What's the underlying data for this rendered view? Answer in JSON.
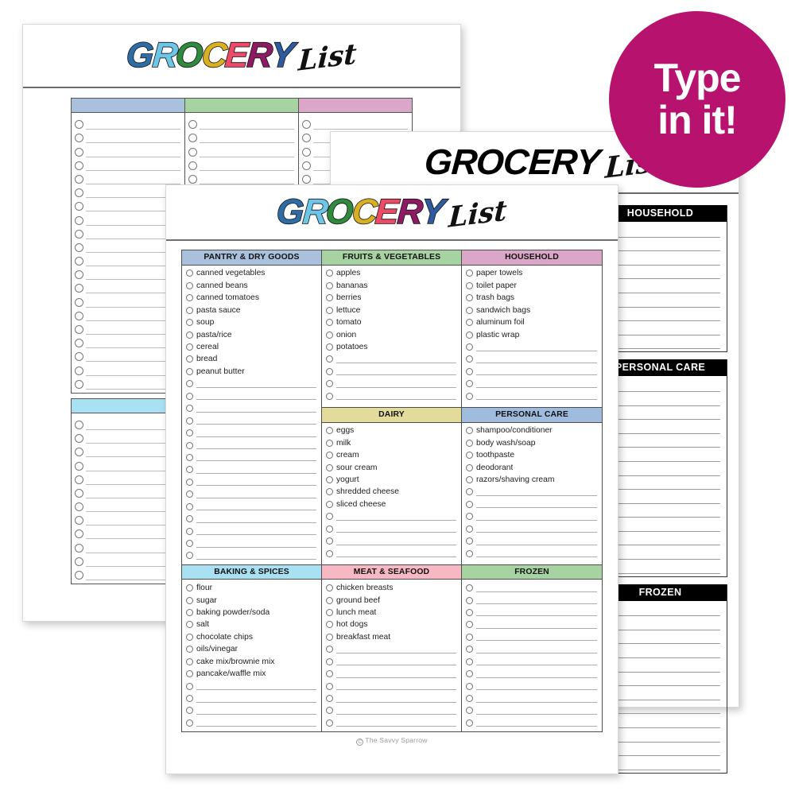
{
  "badge": {
    "line1": "Type",
    "line2": "in it!",
    "color": "#b7136e"
  },
  "logo": {
    "letters": [
      {
        "ch": "G",
        "color": "#2e6ca6"
      },
      {
        "ch": "R",
        "color": "#6dc5e8"
      },
      {
        "ch": "O",
        "color": "#2f8a3e"
      },
      {
        "ch": "C",
        "color": "#d9b022"
      },
      {
        "ch": "E",
        "color": "#ec4a67"
      },
      {
        "ch": "R",
        "color": "#8e1a63"
      },
      {
        "ch": "Y",
        "color": "#2d5b9e"
      }
    ],
    "script": "List"
  },
  "front_page": {
    "credit": "The Savvy Sparrow",
    "credit_mark": "C",
    "categories": [
      {
        "title": "PANTRY & DRY GOODS",
        "color": "#a9c1dd",
        "items": [
          "canned vegetables",
          "canned beans",
          "canned tomatoes",
          "pasta sauce",
          "soup",
          "pasta/rice",
          "cereal",
          "bread",
          "peanut butter"
        ],
        "blanks": 15,
        "tall": true
      },
      {
        "title": "FRUITS & VEGETABLES",
        "color": "#a7d3a3",
        "items": [
          "apples",
          "bananas",
          "berries",
          "lettuce",
          "tomato",
          "onion",
          "potatoes"
        ],
        "blanks": 4,
        "tall": false
      },
      {
        "title": "HOUSEHOLD",
        "color": "#dba7c8",
        "items": [
          "paper towels",
          "toilet paper",
          "trash bags",
          "sandwich bags",
          "aluminum foil",
          "plastic wrap"
        ],
        "blanks": 5,
        "tall": false
      },
      {
        "title": "DAIRY",
        "color": "#e3db9a",
        "items": [
          "eggs",
          "milk",
          "cream",
          "sour cream",
          "yogurt",
          "shredded cheese",
          "sliced cheese"
        ],
        "blanks": 4,
        "tall": false
      },
      {
        "title": "PERSONAL CARE",
        "color": "#9fbcdf",
        "items": [
          "shampoo/conditioner",
          "body wash/soap",
          "toothpaste",
          "deodorant",
          "razors/shaving cream"
        ],
        "blanks": 6,
        "tall": false
      },
      {
        "title": "BAKING & SPICES",
        "color": "#a9e0f2",
        "items": [
          "flour",
          "sugar",
          "baking powder/soda",
          "salt",
          "chocolate chips",
          "oils/vinegar",
          "cake mix/brownie mix",
          "pancake/waffle mix"
        ],
        "blanks": 4,
        "tall": false
      },
      {
        "title": "MEAT & SEAFOOD",
        "color": "#f6b8c2",
        "items": [
          "chicken breasts",
          "ground beef",
          "lunch meat",
          "hot dogs",
          "breakfast meat"
        ],
        "blanks": 7,
        "tall": false
      },
      {
        "title": "FROZEN",
        "color": "#a7d3a3",
        "items": [],
        "blanks": 12,
        "tall": false
      }
    ]
  },
  "back_page": {
    "header_colors": [
      "#a9c1dd",
      "#a7d3a3",
      "#dba7c8"
    ],
    "block1_rows": 20,
    "block2_header_color": "#a9e0f2",
    "block2_rows": 12
  },
  "middle_page": {
    "sections": [
      {
        "title": "HOUSEHOLD",
        "rows": 9
      },
      {
        "title": "PERSONAL CARE",
        "rows": 14
      },
      {
        "title": "FROZEN",
        "rows": 12
      }
    ]
  }
}
